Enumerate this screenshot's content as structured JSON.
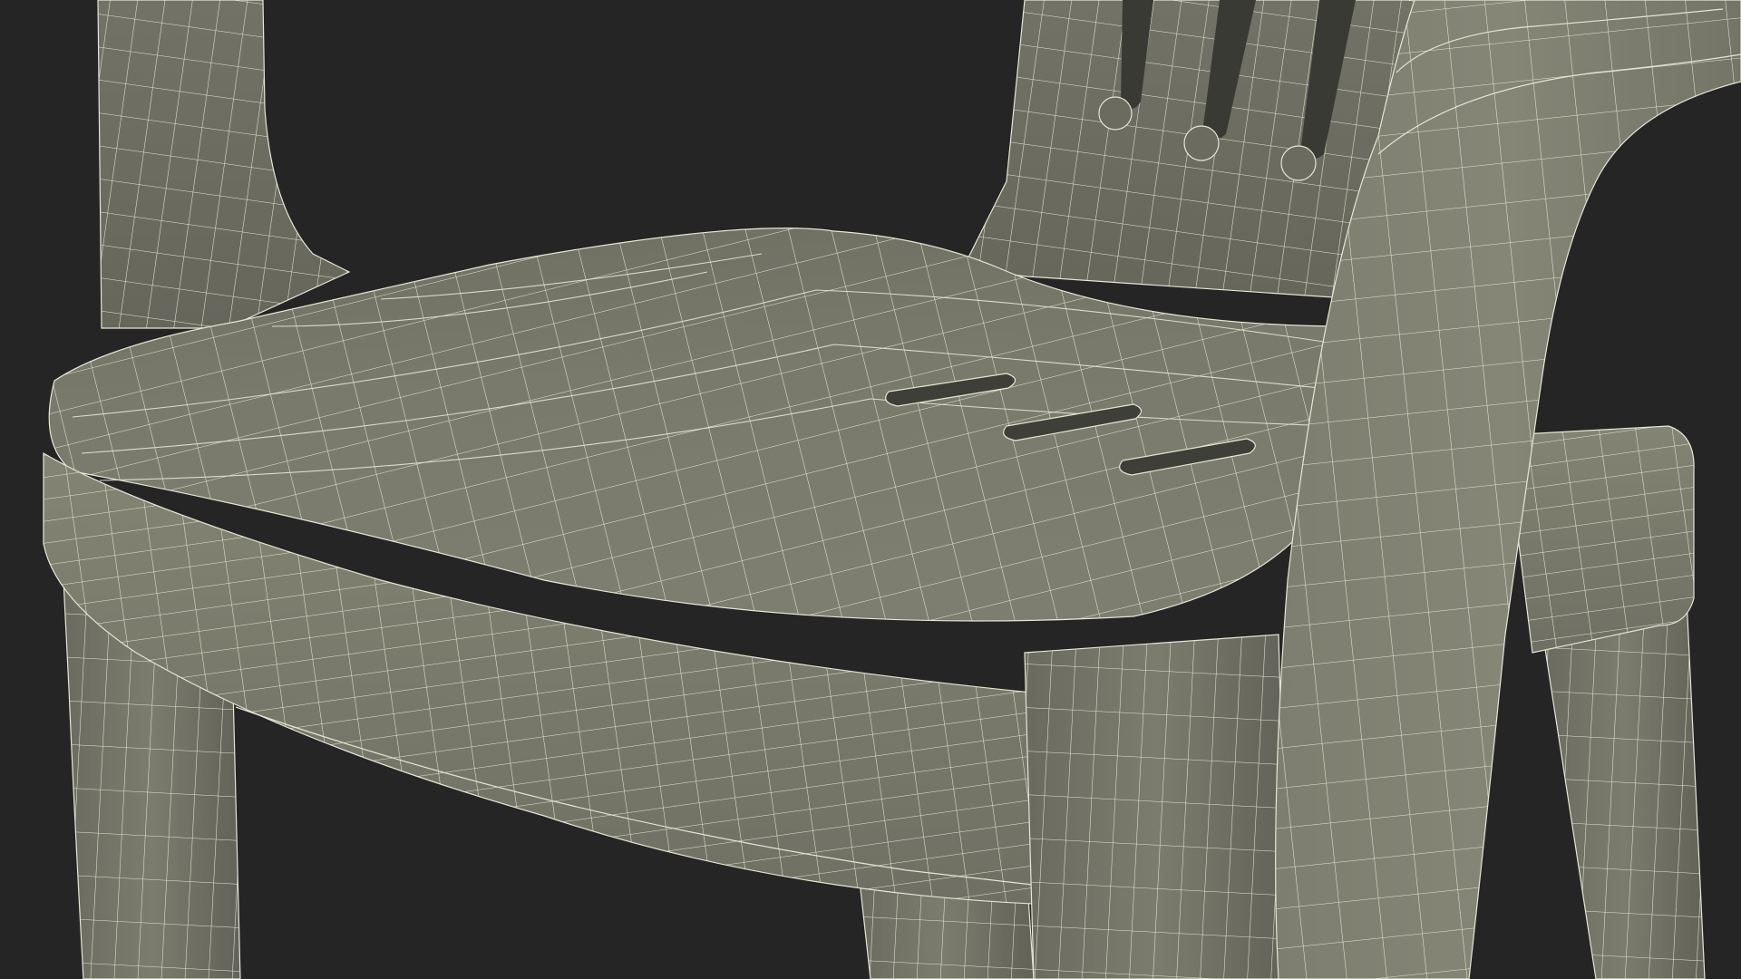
{
  "scene": {
    "subject": "plastic-armchair-wireframe",
    "background_color": "#252525",
    "surface_color": "#7b7b6d",
    "surface_shadow_color": "#5e5e54",
    "surface_highlight_color": "#8b8b7c",
    "wire_color": "#e6e6d6"
  }
}
